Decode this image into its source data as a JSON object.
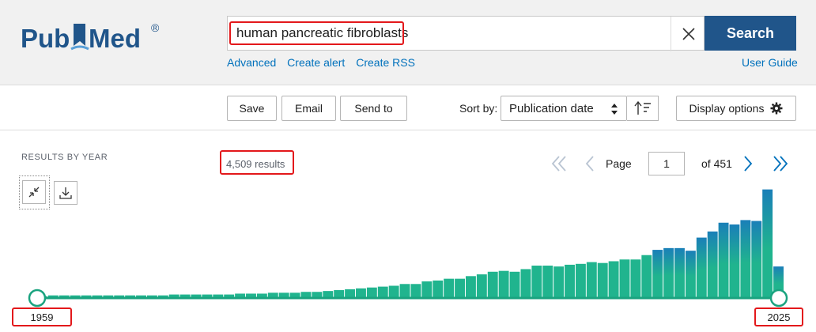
{
  "brand": {
    "logo_text_left": "Pub",
    "logo_text_right": "Med",
    "registered_mark": "®",
    "colors": {
      "dark_blue": "#20558a",
      "accent": "#0071bc",
      "highlight": "#e3181b",
      "bar_green": "#20b48e",
      "bar_blue": "#1a7fb8"
    }
  },
  "search": {
    "query": "human pancreatic fibroblasts",
    "clear_icon": "close-icon",
    "button_label": "Search",
    "links": [
      "Advanced",
      "Create alert",
      "Create RSS"
    ],
    "user_guide": "User Guide"
  },
  "toolbar": {
    "save": "Save",
    "email": "Email",
    "send_to": "Send to",
    "sort_by_label": "Sort by:",
    "sort_value": "Publication date",
    "sort_direction_icon": "sort-descending-icon",
    "display_options": "Display options",
    "display_options_icon": "gear-icon"
  },
  "results": {
    "section_label": "RESULTS BY YEAR",
    "count_text": "4,509 results",
    "collapse_icon": "collapse-icon",
    "download_icon": "download-icon"
  },
  "pagination": {
    "first_icon": "double-chevron-left-icon",
    "prev_icon": "chevron-left-icon",
    "page_label": "Page",
    "current_page": "1",
    "of_text": "of 451",
    "next_icon": "chevron-right-icon",
    "last_icon": "double-chevron-right-icon"
  },
  "timeline": {
    "start_year": "1959",
    "end_year": "2025"
  },
  "chart_data": {
    "type": "bar",
    "x": [
      1959,
      1960,
      1961,
      1962,
      1963,
      1964,
      1965,
      1966,
      1967,
      1968,
      1969,
      1970,
      1971,
      1972,
      1973,
      1974,
      1975,
      1976,
      1977,
      1978,
      1979,
      1980,
      1981,
      1982,
      1983,
      1984,
      1985,
      1986,
      1987,
      1988,
      1989,
      1990,
      1991,
      1992,
      1993,
      1994,
      1995,
      1996,
      1997,
      1998,
      1999,
      2000,
      2001,
      2002,
      2003,
      2004,
      2005,
      2006,
      2007,
      2008,
      2009,
      2010,
      2011,
      2012,
      2013,
      2014,
      2015,
      2016,
      2017,
      2018,
      2019,
      2020,
      2021,
      2022,
      2023,
      2024,
      2025
    ],
    "values": [
      2,
      3,
      3,
      3,
      3,
      3,
      3,
      3,
      3,
      3,
      3,
      3,
      4,
      4,
      4,
      4,
      4,
      4,
      5,
      5,
      5,
      6,
      6,
      6,
      7,
      7,
      8,
      9,
      10,
      11,
      12,
      13,
      14,
      16,
      16,
      19,
      20,
      22,
      22,
      25,
      27,
      30,
      31,
      30,
      33,
      37,
      37,
      36,
      38,
      39,
      41,
      40,
      42,
      44,
      44,
      49,
      55,
      57,
      57,
      54,
      69,
      76,
      86,
      84,
      89,
      88,
      124,
      36
    ],
    "ylim": [
      0,
      130
    ],
    "grid": false,
    "color_scheme": "gradient from green (older years) to blue (recent years)"
  }
}
